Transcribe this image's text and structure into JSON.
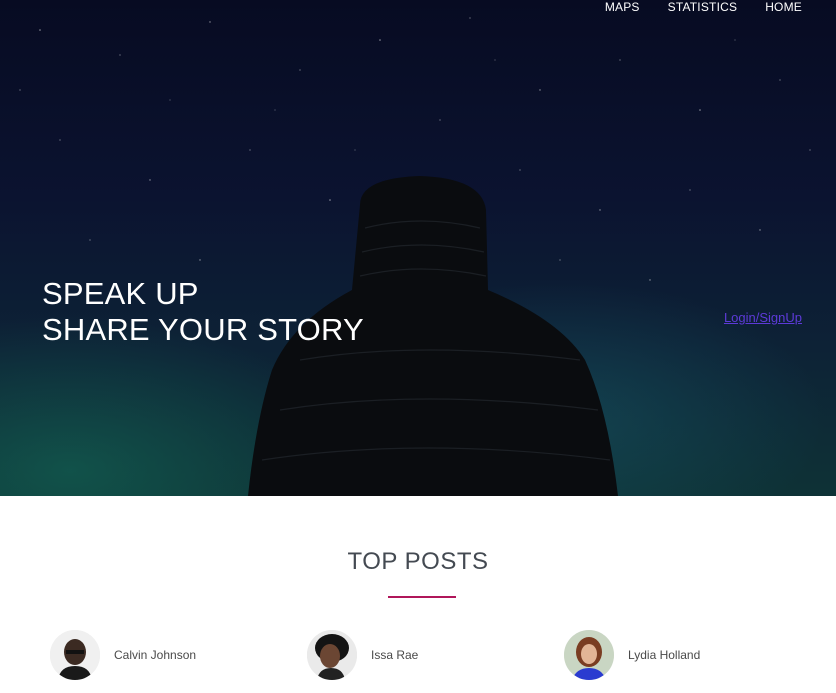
{
  "nav": {
    "items": [
      "MAPS",
      "STATISTICS",
      "HOME"
    ]
  },
  "hero": {
    "headline_line1": "SPEAK UP",
    "headline_line2": "SHARE YOUR STORY",
    "login_label": "Login/SignUp"
  },
  "top_posts": {
    "title": "TOP POSTS",
    "authors": [
      {
        "name": "Calvin Johnson"
      },
      {
        "name": "Issa Rae"
      },
      {
        "name": "Lydia Holland"
      }
    ]
  },
  "colors": {
    "accent_rule": "#b0165a",
    "login_link": "#5d3ad8"
  }
}
